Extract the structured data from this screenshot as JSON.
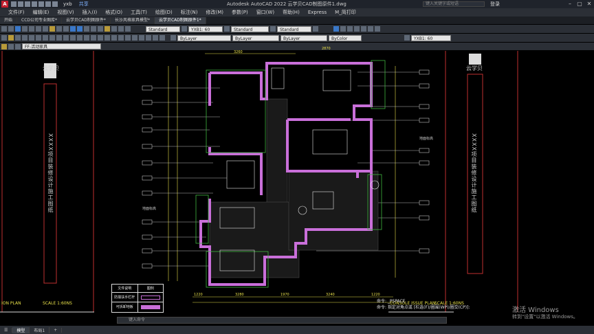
{
  "app": {
    "window_title": "Autodesk AutoCAD 2022   云学贝CAD制图原件1.dwg",
    "workspace": "yxb",
    "share_label": "共享",
    "search_placeholder": "键入关键字或短语",
    "login": "登录",
    "logo_letter": "A"
  },
  "menu": [
    "文件(F)",
    "编辑(E)",
    "视图(V)",
    "插入(I)",
    "格式(O)",
    "工具(T)",
    "绘图(D)",
    "标注(N)",
    "修改(M)",
    "参数(P)",
    "窗口(W)",
    "帮助(H)",
    "Express",
    "M_简打印"
  ],
  "tabs": [
    {
      "label": "开始",
      "active": false
    },
    {
      "label": "CCD公司专业图库*",
      "active": false
    },
    {
      "label": "云学贝CAD制图原件*",
      "active": false
    },
    {
      "label": "长沙风格家具模型*",
      "active": false
    },
    {
      "label": "云学贝CAD制图原件1*",
      "active": true
    }
  ],
  "toolbar": {
    "style1": "Standard",
    "style2": "YXB1: 60",
    "style3": "Standard",
    "style4": "Standard",
    "layer": "FF-活动家具",
    "color": "ByLayer",
    "linetype": "ByLayer",
    "lineweight": "ByLayer",
    "plotstyle": "ByColor",
    "annoscale": "YXB1: 60"
  },
  "drawing": {
    "left_brand": "云学贝",
    "right_brand": "云学贝",
    "left_vertical": "XXXX项目装修设计施工图纸",
    "right_vertical": "XXXX项目装修设计施工图纸",
    "left_footer": "ION PLAN",
    "left_scale": "SCALE 1:60NS",
    "right_footer": "-CONSOLE ISSUE PLAN",
    "right_scale": "SCALE 1:60NS",
    "dim_top_1": "3260",
    "dim_top_2": "2870",
    "dim_bottom": [
      "1220",
      "3280",
      "1970",
      "3240",
      "1220"
    ],
    "floor_label": "地面标高",
    "legend_title_1": "文件说明",
    "legend_title_2": "图例",
    "legend_row_1": "防撞扶手栏杆",
    "legend_row_2": "可拆卸地板"
  },
  "command": {
    "lines": [
      "命令: _PSPACE",
      "命令: 指定对角点或 [栏选(F)/圈围(WP)/圈交(CP)]:"
    ],
    "placeholder": "键入命令"
  },
  "status": {
    "tabs": [
      {
        "label": "模型",
        "active": true
      },
      {
        "label": "布局1",
        "active": false
      }
    ]
  },
  "watermark": {
    "line1": "激活 Windows",
    "line2": "转到\"设置\"以激活 Windows。"
  },
  "colors": {
    "background": "#000000",
    "wall": "#c96fd9",
    "dim": "#e8e04a",
    "green": "#3fb43f",
    "white": "#e6e6e6"
  }
}
